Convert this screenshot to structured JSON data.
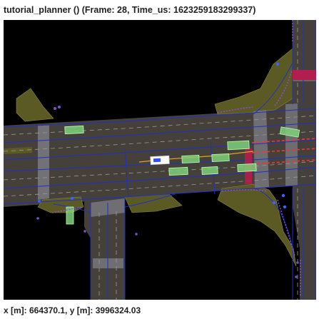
{
  "window": {
    "title": "tutorial_planner () (Frame: 28, Time_us: 1623259183299337)"
  },
  "status": {
    "coordinates": "x [m]: 664370.1, y [m]: 3996324.03"
  },
  "map": {
    "colors": {
      "background": "#000000",
      "drivable": "#45413a",
      "sidewalk": "#5c5a24",
      "crosswalk": "#77777c",
      "lane_blue": "#1f2fc8",
      "lane_divider": "#9a9a9a",
      "vehicle": "#7fd07a",
      "ego": "#ffffff",
      "stop_line": "#b21e50",
      "route_red": "#ff3030",
      "pedestrian": "#7a4fd0",
      "cyclist": "#3b63ff"
    },
    "icons": [
      "ego-vehicle-icon",
      "vehicle-box-icon",
      "pedestrian-icon"
    ]
  }
}
